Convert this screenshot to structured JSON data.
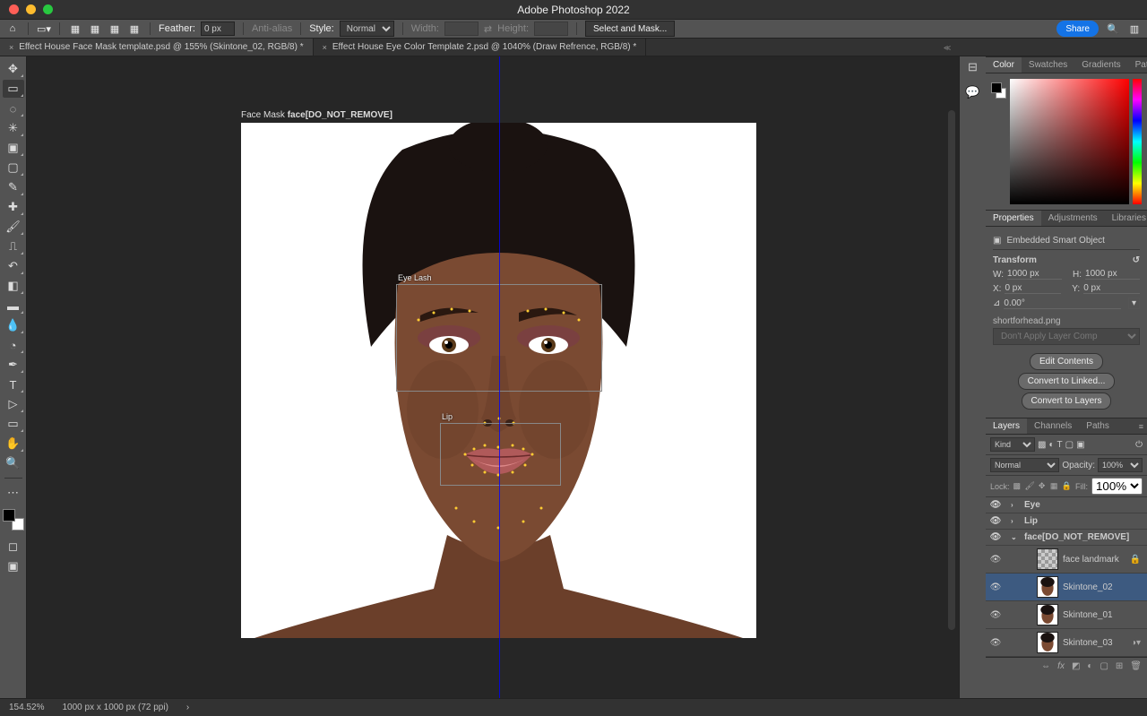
{
  "app_title": "Adobe Photoshop 2022",
  "topbar": {
    "feather_label": "Feather:",
    "feather_value": "0 px",
    "aa_label": "Anti-alias",
    "style_label": "Style:",
    "style_value": "Normal",
    "width_label": "Width:",
    "height_label": "Height:",
    "select_mask": "Select and Mask...",
    "share": "Share"
  },
  "tabs": [
    {
      "label": "Effect House Face Mask template.psd @ 155% (Skintone_02, RGB/8) *",
      "active": true
    },
    {
      "label": "Effect House Eye Color Template 2.psd @ 1040% (Draw Refrence, RGB/8) *",
      "active": false
    }
  ],
  "canvas": {
    "label_prefix": "Face Mask ",
    "label_bold": "face[DO_NOT_REMOVE]",
    "eye_label": "Eye Lash",
    "lip_label": "Lip"
  },
  "panels": {
    "color": {
      "tabs": [
        "Color",
        "Swatches",
        "Gradients",
        "Patterns"
      ]
    },
    "properties": {
      "tabs": [
        "Properties",
        "Adjustments",
        "Libraries"
      ],
      "type": "Embedded Smart Object",
      "section": "Transform",
      "w_label": "W:",
      "w": "1000 px",
      "h_label": "H:",
      "h": "1000 px",
      "x_label": "X:",
      "x": "0 px",
      "y_label": "Y:",
      "y": "0 px",
      "angle": "0.00°",
      "file": "shortforhead.png",
      "layer_comp": "Don't Apply Layer Comp",
      "btn1": "Edit Contents",
      "btn2": "Convert to Linked...",
      "btn3": "Convert to Layers"
    },
    "layers": {
      "tabs": [
        "Layers",
        "Channels",
        "Paths"
      ],
      "filter": "Kind",
      "blend": "Normal",
      "opacity_label": "Opacity:",
      "opacity": "100%",
      "lock_label": "Lock:",
      "fill_label": "Fill:",
      "fill": "100%",
      "items": [
        {
          "type": "group",
          "name": "Eye",
          "open": false
        },
        {
          "type": "group",
          "name": "Lip",
          "open": false
        },
        {
          "type": "group",
          "name": "face[DO_NOT_REMOVE]",
          "open": true,
          "sel": false
        },
        {
          "type": "layer",
          "name": "face landmark",
          "thumb": "trans",
          "locked": true,
          "indent": 1
        },
        {
          "type": "layer",
          "name": "Skintone_02",
          "thumb": "face",
          "sel": true,
          "indent": 1
        },
        {
          "type": "layer",
          "name": "Skintone_01",
          "thumb": "face",
          "indent": 1
        },
        {
          "type": "layer",
          "name": "Skintone_03",
          "thumb": "face",
          "indent": 1
        }
      ]
    }
  },
  "status": {
    "zoom": "154.52%",
    "dims": "1000 px x 1000 px (72 ppi)"
  }
}
